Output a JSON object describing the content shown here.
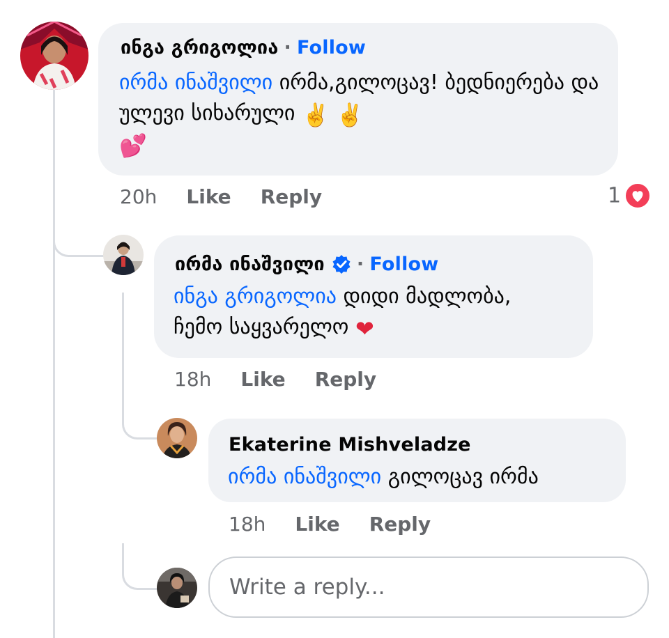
{
  "comments": [
    {
      "author": "ინგა გრიგოლია",
      "follow_label": "Follow",
      "mention": "ირმა ინაშვილი",
      "text": "ირმა,გილოცავ! ბედნიერება და ულევი სიხარული",
      "emojis": [
        "victory-hand-emoji",
        "victory-hand-emoji",
        "two-hearts-emoji"
      ],
      "time": "20h",
      "like_label": "Like",
      "reply_label": "Reply",
      "reaction_count": "1",
      "reaction": "love-reaction-icon"
    },
    {
      "author": "ირმა ინაშვილი",
      "verified": true,
      "follow_label": "Follow",
      "mention": "ინგა გრიგოლია",
      "text_line1": "დიდი მადლობა,",
      "text_line2": "ჩემო საყვარელო",
      "emojis": [
        "red-heart-emoji"
      ],
      "time": "18h",
      "like_label": "Like",
      "reply_label": "Reply"
    },
    {
      "author": "Ekaterine Mishveladze",
      "mention": "ირმა ინაშვილი",
      "text": "გილოცავ ირმა",
      "time": "18h",
      "like_label": "Like",
      "reply_label": "Reply"
    }
  ],
  "reply_box": {
    "placeholder": "Write a reply..."
  },
  "colors": {
    "link": "#0866ff",
    "bubble": "#f0f2f5",
    "meta": "#65676b",
    "love": "#f33e58"
  }
}
